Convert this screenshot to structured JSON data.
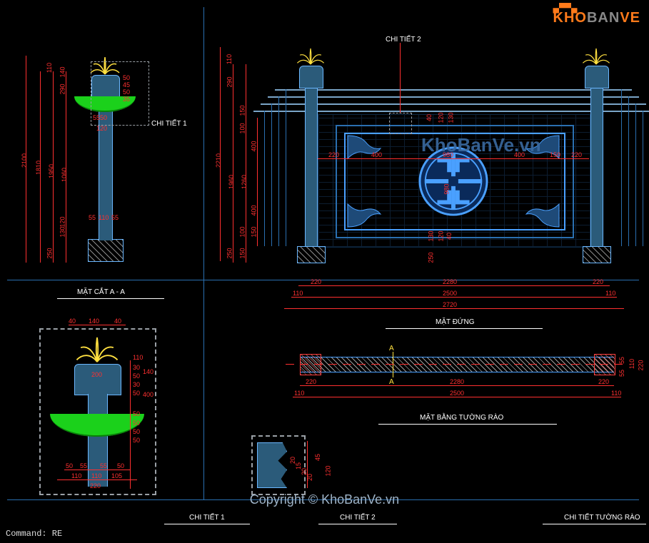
{
  "logo": {
    "brand_a": "KHO",
    "brand_b": "BAN",
    "brand_c": "VE"
  },
  "watermark": "KhoBanVe.vn",
  "copyright": "Copyright © KhoBanVe.vn",
  "command_prompt": "Command: RE",
  "labels": {
    "section_a": "MẶT CẮT A - A",
    "elevation": "MẶT ĐỨNG",
    "plan": "MẶT BẰNG TƯỜNG RÀO",
    "detail1": "CHI TIẾT 1",
    "detail2": "CHI TIẾT 2",
    "detail_wall": "CHI TIẾT TƯỜNG RÀO",
    "detail1_callout": "CHI TIẾT 1",
    "detail2_callout": "CHI TIẾT 2",
    "section_marker": "A"
  },
  "dims": {
    "section": {
      "total_h": "2100",
      "shaft_h": "1810",
      "inner_h": "1950",
      "mid_h": "1060",
      "base_h": "250",
      "band_h": "120",
      "tile_w": "5550",
      "cap_h": "290",
      "top_stack": [
        "110",
        "140"
      ],
      "cap_sub": [
        "50",
        "45",
        "50",
        "35"
      ],
      "base_stack": [
        "130",
        "120"
      ],
      "inner_stack": [
        "55",
        "110",
        "55"
      ]
    },
    "elevation": {
      "total_h": "2210",
      "panel_h": "1260",
      "panel_inner_h": "1960",
      "cap_h": "290",
      "tile_h": "150",
      "base_h": "250",
      "medallion": "980",
      "side_w": "220",
      "panel_w": "2280",
      "overall_w": "2720",
      "pier_w": "110",
      "between_piers": "2500",
      "inner_dims_h": [
        "400",
        "150",
        "100",
        "100",
        "150"
      ],
      "inner_dims_w": [
        "400",
        "400",
        "150",
        "220"
      ],
      "top_dims": [
        "40",
        "120",
        "130"
      ],
      "bot_dims": [
        "130",
        "120",
        "40"
      ],
      "pier_top_h": "110",
      "pier_h_stack": [
        "150",
        "100"
      ]
    },
    "plan": {
      "strip_h": "220",
      "pier_w": "220",
      "inner": "2280",
      "overall": "2500",
      "edge": "110",
      "inner_stack": [
        "55",
        "110",
        "55"
      ]
    },
    "detail1": {
      "w_top": [
        "40",
        "140",
        "40"
      ],
      "w_cap": "200",
      "col_w": "110",
      "band": [
        "50",
        "55",
        "55",
        "50"
      ],
      "overall_w": "220",
      "heights": [
        "110",
        "140",
        "400",
        "30",
        "50",
        "30",
        "50",
        "50",
        "50",
        "50",
        "50"
      ]
    },
    "detail2": {
      "heights": [
        "20",
        "15",
        "20",
        "20",
        "45",
        "120"
      ]
    }
  }
}
